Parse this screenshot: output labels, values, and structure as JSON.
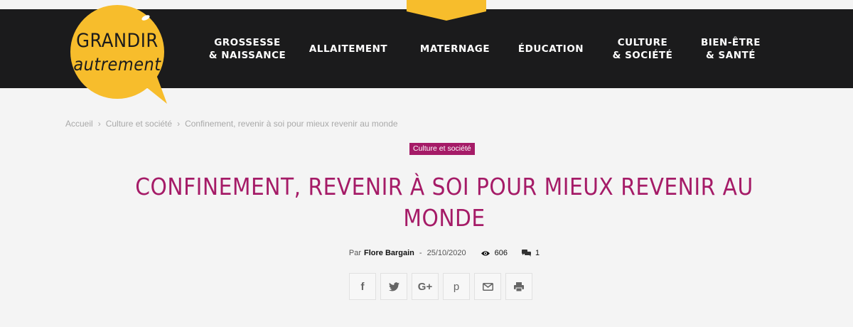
{
  "logo": {
    "line1": "GRANDIR",
    "line2": "autrement"
  },
  "colors": {
    "accent": "#a51b67",
    "brand_yellow": "#f7bd2c",
    "header_bg": "#1b1b1c"
  },
  "nav": {
    "items": [
      {
        "line1": "GROSSESSE",
        "line2": "& NAISSANCE"
      },
      {
        "line1": "ALLAITEMENT",
        "line2": ""
      },
      {
        "line1": "MATERNAGE",
        "line2": ""
      },
      {
        "line1": "ÉDUCATION",
        "line2": ""
      },
      {
        "line1": "CULTURE",
        "line2": "& SOCIÉTÉ"
      },
      {
        "line1": "BIEN-ÊTRE",
        "line2": "& SANTÉ"
      }
    ]
  },
  "breadcrumb": {
    "home": "Accueil",
    "separator": "›",
    "category": "Culture et société",
    "current": "Confinement, revenir à soi pour mieux revenir au monde"
  },
  "article": {
    "category": "Culture et société",
    "title": "CONFINEMENT, REVENIR À SOI POUR MIEUX REVENIR AU MONDE",
    "by": "Par",
    "author": "Flore Bargain",
    "dash": "-",
    "date": "25/10/2020",
    "views": "606",
    "comments": "1"
  },
  "share": {
    "icons": [
      "facebook-icon",
      "twitter-icon",
      "google-plus-icon",
      "pinterest-icon",
      "email-icon",
      "print-icon"
    ],
    "facebook_glyph": "f",
    "googleplus_glyph": "G+",
    "pinterest_glyph": "p"
  }
}
